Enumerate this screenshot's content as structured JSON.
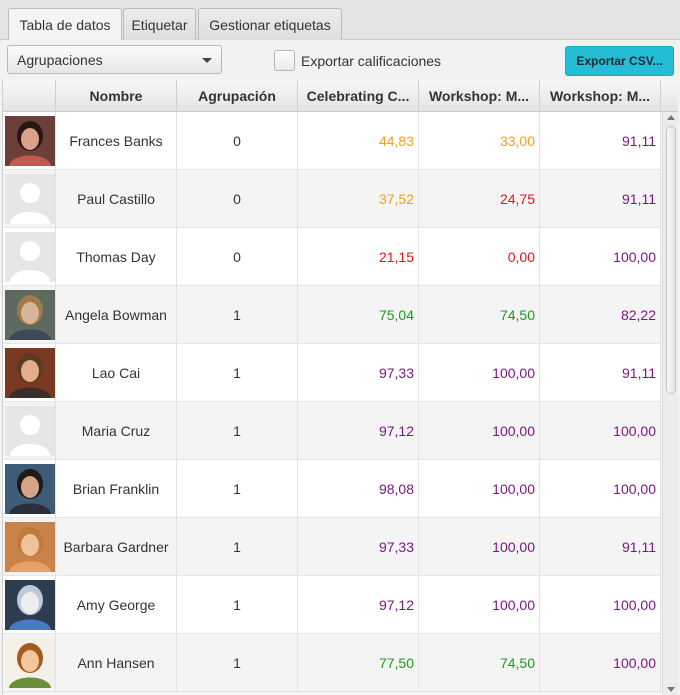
{
  "tabs": [
    {
      "label": "Tabla de datos",
      "active": true
    },
    {
      "label": "Etiquetar",
      "active": false
    },
    {
      "label": "Gestionar etiquetas",
      "active": false
    }
  ],
  "toolbar": {
    "grouping_select": "Agrupaciones",
    "export_grades_label": "Exportar calificaciones",
    "export_grades_checked": false,
    "export_csv_label": "Exportar CSV..."
  },
  "table": {
    "columns": [
      "",
      "Nombre",
      "Agrupación",
      "Celebrating C...",
      "Workshop: M...",
      "Workshop: M..."
    ],
    "rows": [
      {
        "avatar": "photo-woman-dark-hair",
        "name": "Frances Banks",
        "group": "0",
        "scores": [
          "44,83",
          "33,00",
          "91,11"
        ],
        "score_colors": [
          "orange",
          "orange",
          "purple"
        ]
      },
      {
        "avatar": "default-silhouette",
        "name": "Paul Castillo",
        "group": "0",
        "scores": [
          "37,52",
          "24,75",
          "91,11"
        ],
        "score_colors": [
          "orange",
          "red",
          "purple"
        ]
      },
      {
        "avatar": "default-silhouette",
        "name": "Thomas Day",
        "group": "0",
        "scores": [
          "21,15",
          "0,00",
          "100,00"
        ],
        "score_colors": [
          "red",
          "red",
          "purple"
        ]
      },
      {
        "avatar": "photo-woman-blonde",
        "name": "Angela Bowman",
        "group": "1",
        "scores": [
          "75,04",
          "74,50",
          "82,22"
        ],
        "score_colors": [
          "green",
          "green",
          "purple"
        ]
      },
      {
        "avatar": "photo-man-young",
        "name": "Lao Cai",
        "group": "1",
        "scores": [
          "97,33",
          "100,00",
          "91,11"
        ],
        "score_colors": [
          "purple",
          "purple",
          "purple"
        ]
      },
      {
        "avatar": "default-silhouette",
        "name": "Maria Cruz",
        "group": "1",
        "scores": [
          "97,12",
          "100,00",
          "100,00"
        ],
        "score_colors": [
          "purple",
          "purple",
          "purple"
        ]
      },
      {
        "avatar": "photo-man-dark-hair",
        "name": "Brian Franklin",
        "group": "1",
        "scores": [
          "98,08",
          "100,00",
          "100,00"
        ],
        "score_colors": [
          "purple",
          "purple",
          "purple"
        ]
      },
      {
        "avatar": "photo-woman-smiling",
        "name": "Barbara Gardner",
        "group": "1",
        "scores": [
          "97,33",
          "100,00",
          "91,11"
        ],
        "score_colors": [
          "purple",
          "purple",
          "purple"
        ]
      },
      {
        "avatar": "photo-cartoon-drink",
        "name": "Amy George",
        "group": "1",
        "scores": [
          "97,12",
          "100,00",
          "100,00"
        ],
        "score_colors": [
          "purple",
          "purple",
          "purple"
        ]
      },
      {
        "avatar": "photo-cartoon-glasses",
        "name": "Ann Hansen",
        "group": "1",
        "scores": [
          "77,50",
          "74,50",
          "100,00"
        ],
        "score_colors": [
          "green",
          "green",
          "purple"
        ]
      }
    ]
  },
  "colors": {
    "orange": "#f2a11a",
    "red": "#e4141c",
    "green": "#1f9a1f",
    "purple": "#7b167f",
    "accent_button": "#25bcd6"
  }
}
